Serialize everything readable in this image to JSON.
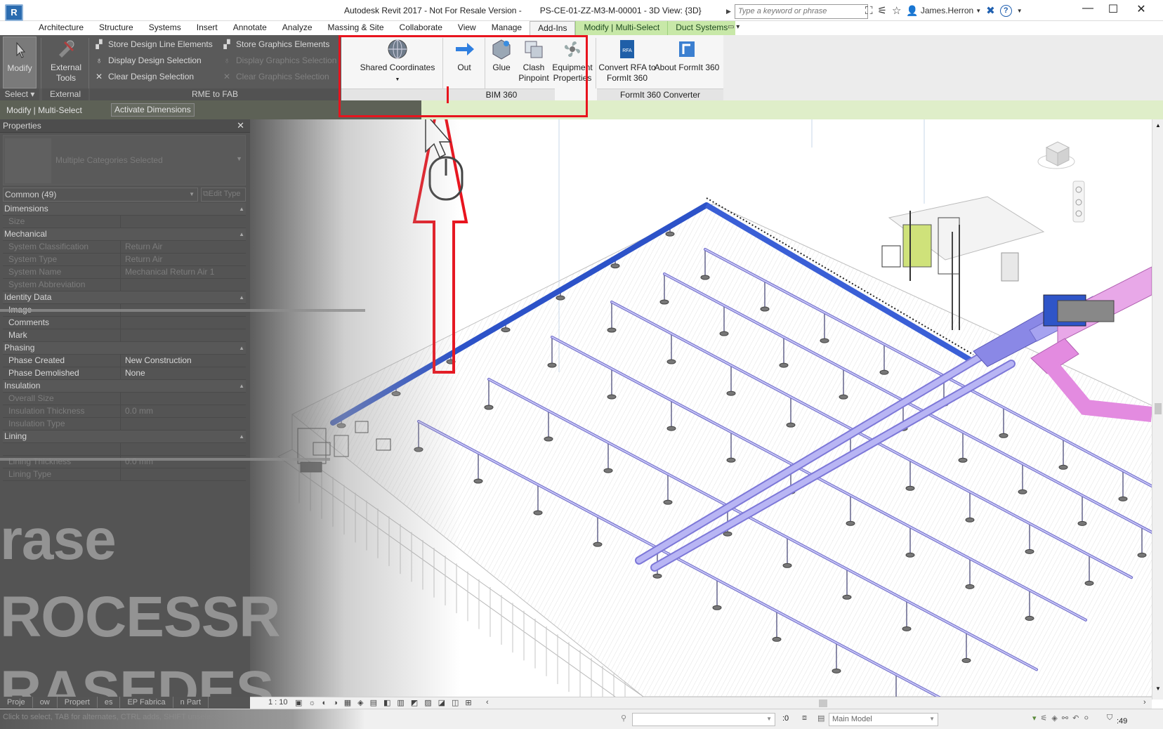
{
  "titlebar": {
    "app_logo": "R",
    "title_app": "Autodesk Revit 2017 - Not For Resale Version -",
    "title_doc": "PS-CE-01-ZZ-M3-M-00001 - 3D View: {3D}",
    "search_placeholder": "Type a keyword or phrase",
    "user": "James.Herron"
  },
  "tabs": [
    "Architecture",
    "Structure",
    "Systems",
    "Insert",
    "Annotate",
    "Analyze",
    "Massing & Site",
    "Collaborate",
    "View",
    "Manage",
    "Add-Ins",
    "Modify | Multi-Select",
    "Duct Systems"
  ],
  "ribbon": {
    "modify_label": "Modify",
    "select_label": "Select",
    "external_tools_label": "External Tools",
    "external_label": "External",
    "store_design_line": "Store Design Line Elements",
    "display_design_selection": "Display Design Selection",
    "clear_design_selection": "Clear Design Selection",
    "store_graphics": "Store Graphics Elements",
    "display_graphics": "Display Graphics Selection",
    "clear_graphics": "Clear Graphics Selection",
    "rme_to_fab": "RME to FAB",
    "shared_coordinates": "Shared Coordinates",
    "out": "Out",
    "glue": "Glue",
    "clash_pinpoint": "Clash Pinpoint",
    "equipment_properties": "Equipment Properties",
    "bim360": "BIM 360",
    "convert_rfa": "Convert RFA to FormIt 360",
    "about_formit": "About FormIt 360",
    "formit_converter": "FormIt 360 Converter"
  },
  "options_bar": {
    "context": "Modify | Multi-Select",
    "activate_dimensions": "Activate Dimensions"
  },
  "properties": {
    "title": "Properties",
    "type_selector": "Multiple Categories Selected",
    "filter": "Common (49)",
    "edit_type": "Edit Type",
    "rows": [
      {
        "kind": "section",
        "name": "Dimensions"
      },
      {
        "kind": "dim",
        "name": "Size",
        "value": ""
      },
      {
        "kind": "section",
        "name": "Mechanical"
      },
      {
        "kind": "dim",
        "name": "System Classification",
        "value": "Return Air"
      },
      {
        "kind": "dim",
        "name": "System Type",
        "value": "Return Air"
      },
      {
        "kind": "dim",
        "name": "System Name",
        "value": "Mechanical Return Air 1"
      },
      {
        "kind": "dim",
        "name": "System Abbreviation",
        "value": ""
      },
      {
        "kind": "section",
        "name": "Identity Data"
      },
      {
        "kind": "normal",
        "name": "Image",
        "value": ""
      },
      {
        "kind": "normal",
        "name": "Comments",
        "value": ""
      },
      {
        "kind": "normal",
        "name": "Mark",
        "value": ""
      },
      {
        "kind": "section",
        "name": "Phasing"
      },
      {
        "kind": "normal",
        "name": "Phase Created",
        "value": "New Construction"
      },
      {
        "kind": "normal",
        "name": "Phase Demolished",
        "value": "None"
      },
      {
        "kind": "section",
        "name": "Insulation"
      },
      {
        "kind": "dim",
        "name": "Overall Size",
        "value": ""
      },
      {
        "kind": "dim",
        "name": "Insulation Thickness",
        "value": "0.0 mm"
      },
      {
        "kind": "dim",
        "name": "Insulation Type",
        "value": ""
      },
      {
        "kind": "section",
        "name": "Lining"
      },
      {
        "kind": "dim",
        "name": "",
        "value": ""
      },
      {
        "kind": "dim",
        "name": "Lining Thickness",
        "value": "0.0 mm"
      },
      {
        "kind": "dim",
        "name": "Lining Type",
        "value": ""
      }
    ]
  },
  "overlay_text": [
    "rase",
    "ROCESSR",
    "RASEDES"
  ],
  "bottom": {
    "project_tabs": [
      "Proje",
      "ow",
      "Propert",
      "es",
      "EP Fabrica",
      "n Part"
    ],
    "scale": "1 : 10",
    "status": "Click to select, TAB for alternates, CTRL adds, SHIFT unselects.",
    "workset_value": ":0",
    "model": "Main Model",
    "selection_count": ":49"
  },
  "colors": {
    "highlight_box": "#e8141e",
    "arrow": "#e8141e",
    "duct_blue": "#3a5fd6",
    "pipe_lavender": "#a9a6f0",
    "duct_pink": "#e38be0"
  }
}
